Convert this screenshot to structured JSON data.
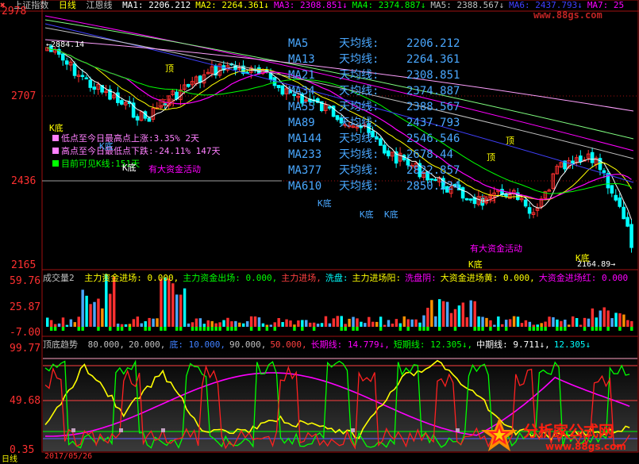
{
  "header": {
    "icon": "close-icon",
    "title": "上证指数",
    "period": "日线",
    "indicator": "江恩线",
    "ma": [
      {
        "label": "MA1: 2206.212",
        "color": "#ffffff"
      },
      {
        "label": "MA2: 2264.361↓",
        "color": "#ffff00"
      },
      {
        "label": "MA3: 2308.851↓",
        "color": "#ff00ff"
      },
      {
        "label": "MA4: 2374.887↓",
        "color": "#00ff00"
      },
      {
        "label": "MA5: 2388.567↓",
        "color": "#c0c0c0"
      },
      {
        "label": "MA6: 2437.793↓",
        "color": "#4040ff"
      },
      {
        "label": "MA7: 25",
        "color": "#ff00ff"
      }
    ]
  },
  "price_axis": {
    "top": "2978",
    "upper": "2707",
    "lower": "2436",
    "bottom": "2165"
  },
  "ma_list": [
    {
      "name": "MA5",
      "desc": "天均线:",
      "value": "2206.212"
    },
    {
      "name": "MA13",
      "desc": "天均线:",
      "value": "2264.361"
    },
    {
      "name": "MA21",
      "desc": "天均线:",
      "value": "2308.851"
    },
    {
      "name": "MA34",
      "desc": "天均线:",
      "value": "2374.887"
    },
    {
      "name": "MA55",
      "desc": "天均线:",
      "value": "2388.567"
    },
    {
      "name": "MA89",
      "desc": "天均线:",
      "value": "2437.793"
    },
    {
      "name": "MA144",
      "desc": "天均线:",
      "value": "2546.546"
    },
    {
      "name": "MA233",
      "desc": "天均线:",
      "value": "2678.44"
    },
    {
      "name": "MA377",
      "desc": "天均线:",
      "value": "2822.857"
    },
    {
      "name": "MA610",
      "desc": "天均线:",
      "value": "2850.224"
    }
  ],
  "stats": [
    {
      "text": "低点至今日最高点上涨:3.35%   2天",
      "box": "#ff80ff",
      "color": "#ff80ff"
    },
    {
      "text": "高点至今日最低点下跌:-24.11%  147天",
      "box": "#ff80ff",
      "color": "#ff80ff"
    },
    {
      "text": "目前可见K线:151天",
      "box": "#00ff00",
      "color": "#00ff00"
    }
  ],
  "annotations": {
    "high_price": "2884.14",
    "low_price": "2164.89",
    "top": "顶",
    "bottom": "底",
    "k_bottom": "K底",
    "inflow": "有大资金活动",
    "bottom_back": "底背"
  },
  "volume_panel": {
    "title": "成交量2",
    "items": [
      {
        "text": "主力资金进场: 0.000,",
        "color": "#ffff00"
      },
      {
        "text": "主力资金出场: 0.000,",
        "color": "#00ff00"
      },
      {
        "text": "主力进场,",
        "color": "#ff4040"
      },
      {
        "text": "洗盘:",
        "color": "#00ffff"
      },
      {
        "text": "主力进场阳:",
        "color": "#ffff00"
      },
      {
        "text": "洗盘阴:",
        "color": "#ff00ff"
      },
      {
        "text": "大资金进场黄: 0.000,",
        "color": "#ffff00"
      },
      {
        "text": "大资金进场红: 0.000",
        "color": "#ff00ff"
      }
    ],
    "axis": {
      "top": "59.76",
      "mid": "25.87",
      "bottom": "-7.00"
    }
  },
  "trend_panel": {
    "title": "顶底趋势",
    "items": [
      {
        "text": "80.000,",
        "color": "#c0c0c0"
      },
      {
        "text": "20.000,",
        "color": "#c0c0c0"
      },
      {
        "text": "底: 10.000,",
        "color": "#4080ff"
      },
      {
        "text": "90.000,",
        "color": "#c0c0c0"
      },
      {
        "text": "50.000,",
        "color": "#ff4040"
      },
      {
        "text": "长期线: 14.779↓,",
        "color": "#ff00ff"
      },
      {
        "text": "短期线: 12.305↓,",
        "color": "#00ff00"
      },
      {
        "text": "中期线: 9.711↓,",
        "color": "#ffffff"
      },
      {
        "text": "12.305↓",
        "color": "#00ffff"
      }
    ],
    "axis": {
      "top": "99.77",
      "mid": "49.68",
      "bottom": "0.35"
    }
  },
  "footer": {
    "left": "日线",
    "date": "2017/05/26"
  },
  "watermark": {
    "top": "www.88gs.com",
    "brand": "分析家公式网",
    "url": "www.88gs.com"
  },
  "colors": {
    "up": "#ff3030",
    "down": "#00ffff",
    "frame": "#a01010"
  }
}
